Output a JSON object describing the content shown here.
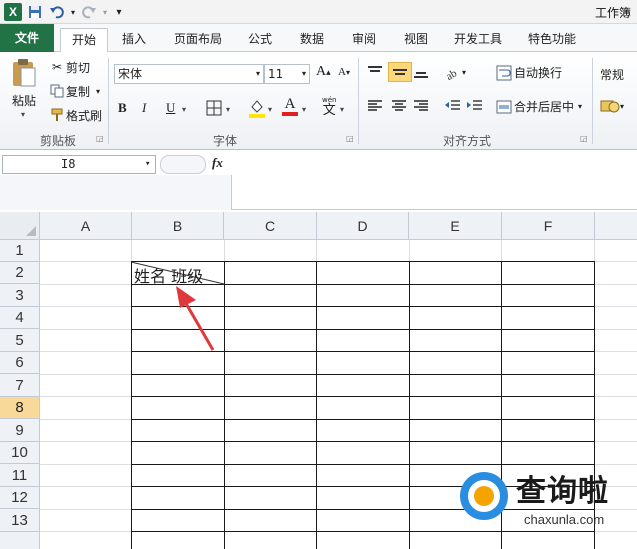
{
  "window": {
    "title": "工作簿"
  },
  "tabs": [
    "文件",
    "开始",
    "插入",
    "页面布局",
    "公式",
    "数据",
    "审阅",
    "视图",
    "开发工具",
    "特色功能"
  ],
  "ribbon": {
    "clipboard": {
      "paste": "粘贴",
      "cut": "剪切",
      "copy": "复制",
      "format_painter": "格式刷",
      "label": "剪贴板"
    },
    "font": {
      "name": "宋体",
      "size": "11",
      "bold": "B",
      "italic": "I",
      "underline": "U",
      "grow": "A",
      "shrink": "A",
      "label": "字体",
      "wen": "wén"
    },
    "alignment": {
      "wrap_text": "自动换行",
      "merge_center": "合并后居中",
      "label": "对齐方式"
    },
    "number": {
      "format": "常规"
    }
  },
  "formula_bar": {
    "name_box": "I8",
    "fx": "fx",
    "value": ""
  },
  "sheet": {
    "columns": [
      "A",
      "B",
      "C",
      "D",
      "E",
      "F"
    ],
    "rows": [
      "1",
      "2",
      "3",
      "4",
      "5",
      "6",
      "7",
      "8",
      "9",
      "10",
      "11",
      "12",
      "13"
    ],
    "selected_row": "8",
    "cells": {
      "B2": "姓名  班级"
    }
  },
  "watermark": {
    "main": "查询啦",
    "sub": "chaxunla.com"
  },
  "colors": {
    "accent": "#217346",
    "annotation_arrow": "#e0393b",
    "selected_header": "#f9d99a"
  }
}
